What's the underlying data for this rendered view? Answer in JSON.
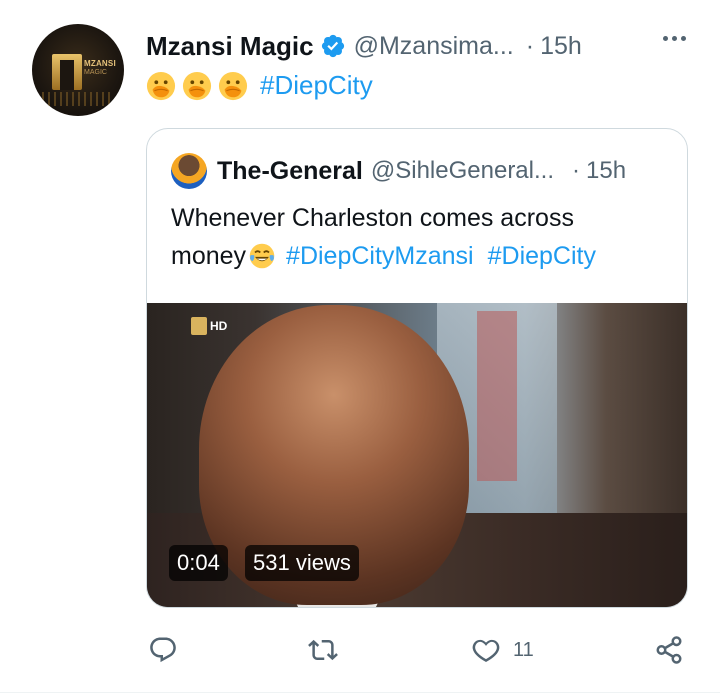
{
  "tweet": {
    "author_name": "Mzansi Magic",
    "author_handle": "@Mzansima...",
    "separator": "·",
    "time": "15h",
    "avatar_logo_text": "MZANSI",
    "avatar_logo_sub": "MAGIC",
    "hashtag": "#DiepCity",
    "emoji_icon": "hand-over-mouth-emoji",
    "emoji_count": 3
  },
  "quote": {
    "author_name": "The-General",
    "author_handle": "@SihleGeneral...",
    "separator": "·",
    "time": "15h",
    "text_line1": "Whenever Charleston comes across",
    "text_line2_word": "money",
    "hashtag1": "#DiepCityMzansi",
    "hashtag2": "#DiepCity",
    "video": {
      "channel_badge": "HD",
      "duration": "0:04",
      "views": "531 views"
    }
  },
  "actions": {
    "reply_icon": "reply-icon",
    "retweet_icon": "retweet-icon",
    "like_icon": "heart-icon",
    "like_count": "11",
    "share_icon": "share-icon"
  },
  "colors": {
    "accent": "#1d9bf0",
    "secondary_text": "#536471",
    "border": "#cfd9de"
  }
}
